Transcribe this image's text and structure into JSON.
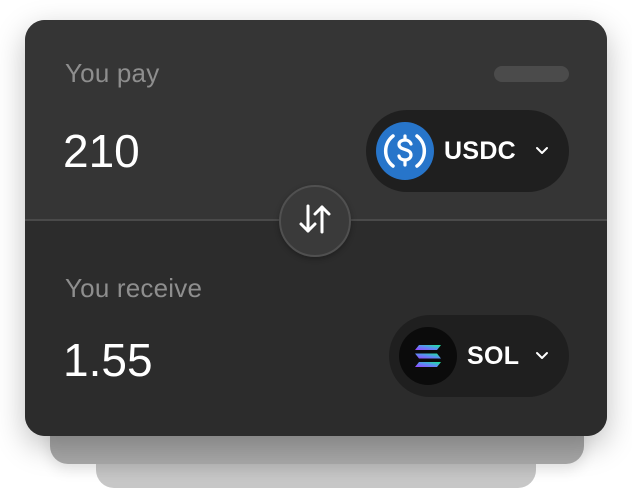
{
  "pay": {
    "label": "You pay",
    "amount": "210",
    "token": {
      "symbol": "USDC",
      "icon": "usdc-logo-icon",
      "color": "#2775ca"
    }
  },
  "receive": {
    "label": "You receive",
    "amount": "1.55",
    "token": {
      "symbol": "SOL",
      "icon": "sol-logo-icon",
      "color": "#0b0b0b"
    }
  },
  "swap": {
    "icon": "swap-arrows-icon"
  },
  "colors": {
    "card": "#353535",
    "token_button": "#1f1f1f",
    "label_text": "#8e8e8e",
    "amount_text": "#ffffff"
  }
}
